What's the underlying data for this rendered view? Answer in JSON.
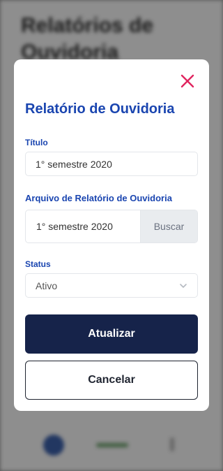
{
  "background": {
    "title": "Relatórios de Ouvidoria"
  },
  "modal": {
    "title": "Relatório de Ouvidoria",
    "close_icon": "close-icon",
    "fields": {
      "titulo": {
        "label": "Título",
        "value": "1° semestre 2020"
      },
      "arquivo": {
        "label": "Arquivo de Relatório de Ouvidoria",
        "file_name": "1° semestre 2020",
        "browse_label": "Buscar"
      },
      "status": {
        "label": "Status",
        "value": "Ativo"
      }
    },
    "buttons": {
      "update_label": "Atualizar",
      "cancel_label": "Cancelar"
    }
  },
  "colors": {
    "accent": "#1a45b0",
    "close": "#e0245e",
    "primary_button": "#16234a"
  }
}
